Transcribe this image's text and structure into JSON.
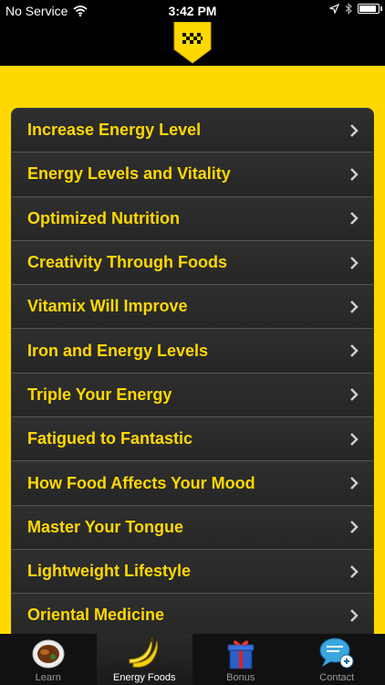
{
  "status_bar": {
    "carrier": "No Service",
    "time": "3:42 PM",
    "battery_level": 0.95
  },
  "header": {
    "logo_icon": "taxi-checker-badge-icon",
    "accent_color": "#FFD800"
  },
  "list": {
    "items": [
      {
        "label": "Increase Energy Level"
      },
      {
        "label": "Energy Levels and Vitality"
      },
      {
        "label": "Optimized Nutrition"
      },
      {
        "label": "Creativity Through Foods"
      },
      {
        "label": "Vitamix Will Improve"
      },
      {
        "label": "Iron and Energy Levels"
      },
      {
        "label": "Triple Your Energy"
      },
      {
        "label": "Fatigued to Fantastic"
      },
      {
        "label": "How Food Affects Your Mood"
      },
      {
        "label": "Master Your Tongue"
      },
      {
        "label": "Lightweight Lifestyle"
      },
      {
        "label": "Oriental Medicine"
      }
    ]
  },
  "tab_bar": {
    "tabs": [
      {
        "label": "Learn",
        "icon": "food-plate-icon",
        "active": false
      },
      {
        "label": "Energy Foods",
        "icon": "banana-icon",
        "active": true
      },
      {
        "label": "Bonus",
        "icon": "gift-icon",
        "active": false
      },
      {
        "label": "Contact",
        "icon": "chat-bubble-add-icon",
        "active": false
      }
    ]
  }
}
